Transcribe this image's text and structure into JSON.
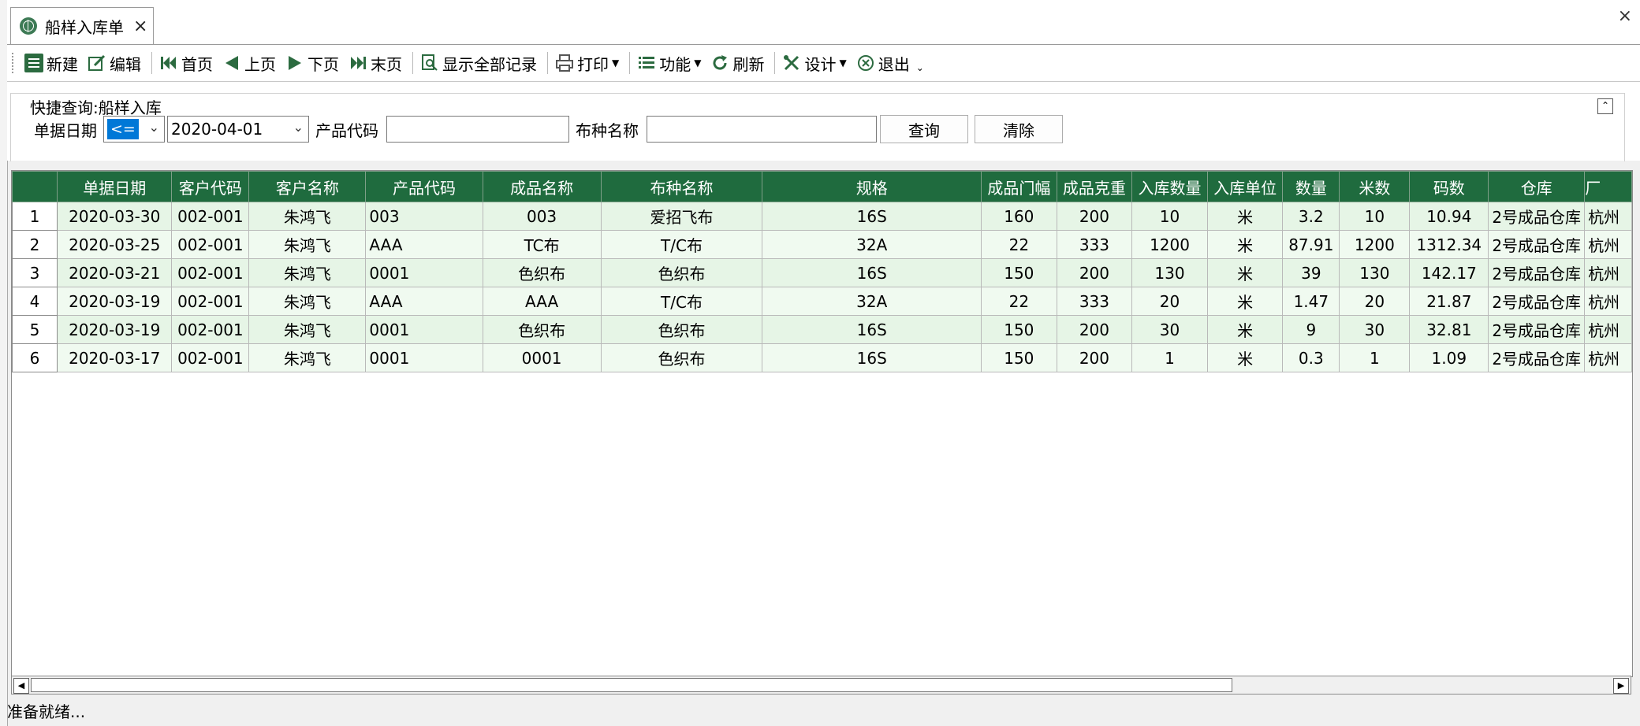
{
  "tab": {
    "title": "船样入库单",
    "close": "×"
  },
  "window": {
    "close": "×"
  },
  "toolbar": {
    "new": "新建",
    "edit": "编辑",
    "first": "首页",
    "prev": "上页",
    "next": "下页",
    "last": "末页",
    "show_all": "显示全部记录",
    "print": "打印",
    "function": "功能",
    "refresh": "刷新",
    "design": "设计",
    "exit": "退出"
  },
  "query": {
    "title": "快捷查询:船样入库",
    "date_label": "单据日期",
    "op_value": "<=",
    "date_value": "2020-04-01",
    "product_code_label": "产品代码",
    "cloth_name_label": "布种名称",
    "search_button": "查询",
    "clear_button": "清除"
  },
  "table": {
    "columns": [
      "单据日期",
      "客户代码",
      "客户名称",
      "产品代码",
      "成品名称",
      "布种名称",
      "规格",
      "成品门幅",
      "成品克重",
      "入库数量",
      "入库单位",
      "数量",
      "米数",
      "码数",
      "仓库",
      "厂"
    ],
    "rows": [
      {
        "n": "1",
        "cells": [
          "2020-03-30",
          "002-001",
          "朱鸿飞",
          "003",
          "003",
          "爱招飞布",
          "16S",
          "160",
          "200",
          "10",
          "米",
          "3.2",
          "10",
          "10.94",
          "2号成品仓库",
          "杭州"
        ]
      },
      {
        "n": "2",
        "cells": [
          "2020-03-25",
          "002-001",
          "朱鸿飞",
          "AAA",
          "TC布",
          "T/C布",
          "32A",
          "22",
          "333",
          "1200",
          "米",
          "87.91",
          "1200",
          "1312.34",
          "2号成品仓库",
          "杭州"
        ]
      },
      {
        "n": "3",
        "cells": [
          "2020-03-21",
          "002-001",
          "朱鸿飞",
          "0001",
          "色织布",
          "色织布",
          "16S",
          "150",
          "200",
          "130",
          "米",
          "39",
          "130",
          "142.17",
          "2号成品仓库",
          "杭州"
        ]
      },
      {
        "n": "4",
        "cells": [
          "2020-03-19",
          "002-001",
          "朱鸿飞",
          "AAA",
          "AAA",
          "T/C布",
          "32A",
          "22",
          "333",
          "20",
          "米",
          "1.47",
          "20",
          "21.87",
          "2号成品仓库",
          "杭州"
        ]
      },
      {
        "n": "5",
        "cells": [
          "2020-03-19",
          "002-001",
          "朱鸿飞",
          "0001",
          "色织布",
          "色织布",
          "16S",
          "150",
          "200",
          "30",
          "米",
          "9",
          "30",
          "32.81",
          "2号成品仓库",
          "杭州"
        ]
      },
      {
        "n": "6",
        "cells": [
          "2020-03-17",
          "002-001",
          "朱鸿飞",
          "0001",
          "0001",
          "色织布",
          "16S",
          "150",
          "200",
          "1",
          "米",
          "0.3",
          "1",
          "1.09",
          "2号成品仓库",
          "杭州"
        ]
      }
    ]
  },
  "status": {
    "text": "准备就绪..."
  },
  "colors": {
    "header_bg": "#1f6b3e",
    "row_bg": "#e6f5e6",
    "row_alt_bg": "#f0faf0",
    "selection": "#0078d7"
  }
}
